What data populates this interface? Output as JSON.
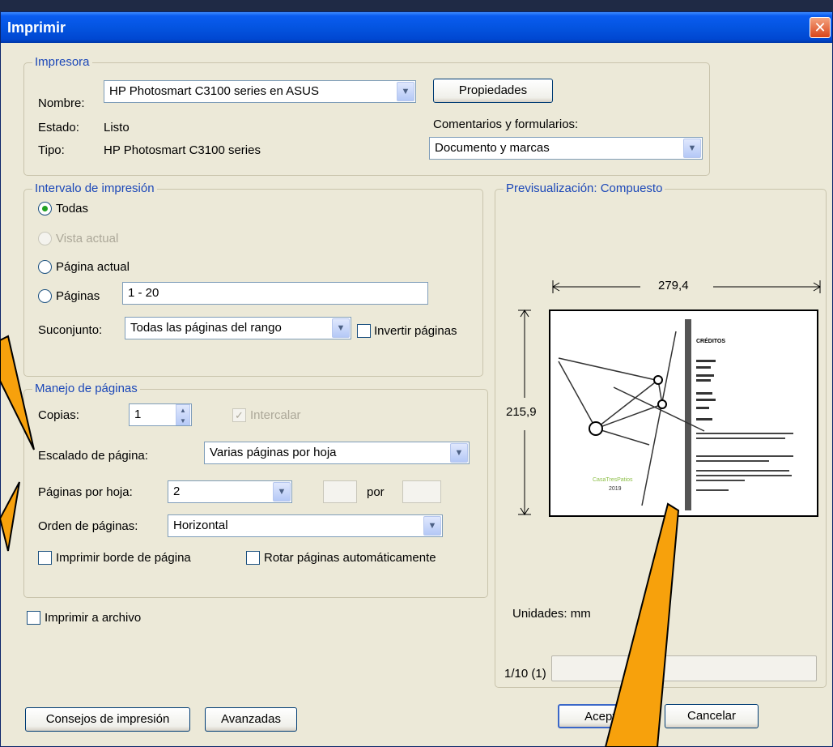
{
  "window": {
    "title": "Imprimir",
    "close_label": "✕"
  },
  "printer": {
    "legend": "Impresora",
    "name_label": "Nombre:",
    "name_value": "HP Photosmart C3100 series en ASUS",
    "properties_button": "Propiedades",
    "status_label": "Estado:",
    "status_value": "Listo",
    "type_label": "Tipo:",
    "type_value": "HP Photosmart C3100 series",
    "comments_label": "Comentarios y formularios:",
    "comments_value": "Documento y marcas"
  },
  "range": {
    "legend": "Intervalo de impresión",
    "all": "Todas",
    "current_view": "Vista actual",
    "current_page": "Página actual",
    "pages": "Páginas",
    "pages_value": "1 - 20",
    "subset_label": "Suconjunto:",
    "subset_value": "Todas las páginas del rango",
    "reverse_label": "Invertir páginas"
  },
  "handling": {
    "legend": "Manejo de páginas",
    "copies_label": "Copias:",
    "copies_value": "1",
    "collate_label": "Intercalar",
    "scaling_label": "Escalado de página:",
    "scaling_value": "Varias páginas por hoja",
    "pps_label": "Páginas por hoja:",
    "pps_value": "2",
    "by_label": "por",
    "order_label": "Orden de páginas:",
    "order_value": "Horizontal",
    "border_label": "Imprimir borde de página",
    "rotate_label": "Rotar páginas automáticamente"
  },
  "print_to_file": "Imprimir a archivo",
  "preview": {
    "legend": "Previsualización: Compuesto",
    "width_value": "279,4",
    "height_value": "215,9",
    "page_heading": "CRÉDITOS",
    "logo_text": "CasaTresPatios",
    "logo_year": "2019",
    "units": "Unidades: mm",
    "page_counter": "1/10 (1)"
  },
  "buttons": {
    "tips": "Consejos de impresión",
    "advanced": "Avanzadas",
    "ok": "Aceptar",
    "cancel": "Cancelar"
  },
  "colors": {
    "titlebar": "#0454e0",
    "callout": "#f7a10c",
    "legend_text": "#1b47b8"
  }
}
